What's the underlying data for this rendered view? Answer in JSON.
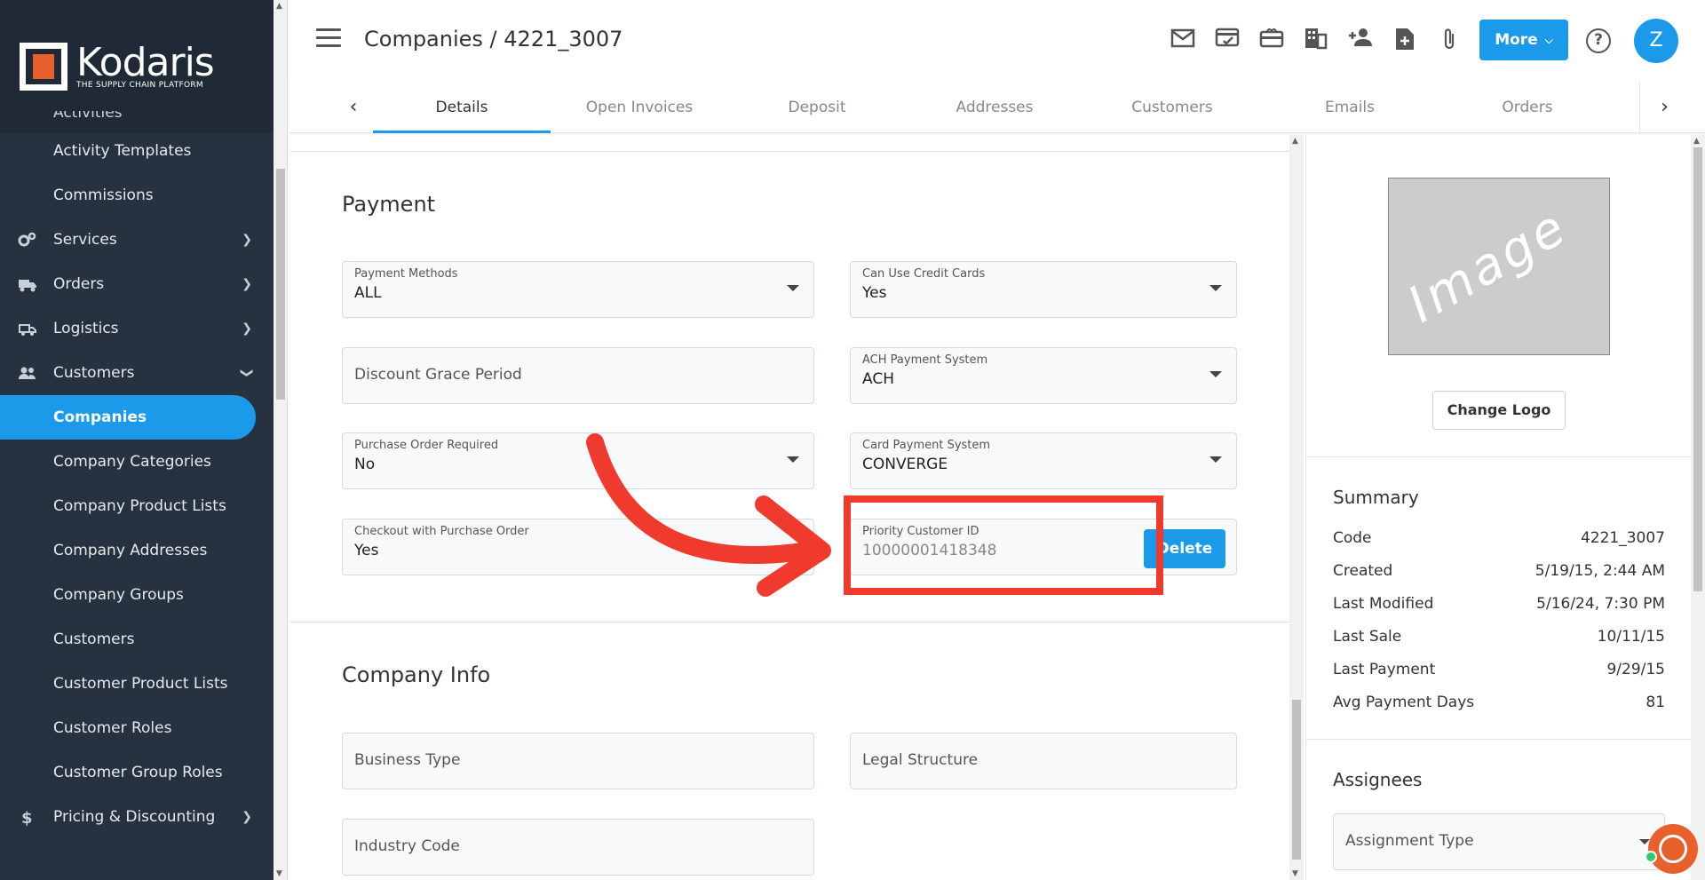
{
  "brand": {
    "name": "Kodaris",
    "tagline": "THE SUPPLY CHAIN PLATFORM",
    "accent": "#1a9ae8",
    "logo_orange": "#e8612c",
    "annotation": "#f03a2e"
  },
  "sidebar": {
    "partial_top": "Activities",
    "items": [
      {
        "label": "Activity Templates",
        "icon": null,
        "chevron": null
      },
      {
        "label": "Commissions",
        "icon": null,
        "chevron": null
      },
      {
        "label": "Services",
        "icon": "gears-icon",
        "chevron": "chevron-right"
      },
      {
        "label": "Orders",
        "icon": "truck-icon",
        "chevron": "chevron-right"
      },
      {
        "label": "Logistics",
        "icon": "delivery-icon",
        "chevron": "chevron-right"
      },
      {
        "label": "Customers",
        "icon": "users-icon",
        "chevron": "chevron-down"
      },
      {
        "label": "Companies",
        "icon": null,
        "chevron": null,
        "active": true
      },
      {
        "label": "Company Categories",
        "icon": null,
        "chevron": null
      },
      {
        "label": "Company Product Lists",
        "icon": null,
        "chevron": null
      },
      {
        "label": "Company Addresses",
        "icon": null,
        "chevron": null
      },
      {
        "label": "Company Groups",
        "icon": null,
        "chevron": null
      },
      {
        "label": "Customers",
        "icon": null,
        "chevron": null
      },
      {
        "label": "Customer Product Lists",
        "icon": null,
        "chevron": null
      },
      {
        "label": "Customer Roles",
        "icon": null,
        "chevron": null
      },
      {
        "label": "Customer Group Roles",
        "icon": null,
        "chevron": null
      },
      {
        "label": "Pricing & Discounting",
        "icon": "dollar-icon",
        "chevron": "chevron-right"
      }
    ]
  },
  "header": {
    "breadcrumb": "Companies / 4221_3007",
    "more_label": "More",
    "avatar_initial": "Z",
    "help_glyph": "?"
  },
  "tabs": [
    "Details",
    "Open Invoices",
    "Deposit",
    "Addresses",
    "Customers",
    "Emails",
    "Orders"
  ],
  "payment": {
    "title": "Payment",
    "payment_methods": {
      "label": "Payment Methods",
      "value": "ALL"
    },
    "can_use_credit_cards": {
      "label": "Can Use Credit Cards",
      "value": "Yes"
    },
    "discount_grace_period": {
      "placeholder": "Discount Grace Period"
    },
    "ach_payment_system": {
      "label": "ACH Payment System",
      "value": "ACH"
    },
    "purchase_order_required": {
      "label": "Purchase Order Required",
      "value": "No"
    },
    "card_payment_system": {
      "label": "Card Payment System",
      "value": "CONVERGE"
    },
    "checkout_with_po": {
      "label": "Checkout with Purchase Order",
      "value": "Yes"
    },
    "priority_customer_id": {
      "label": "Priority Customer ID",
      "value": "10000001418348",
      "delete_label": "Delete"
    }
  },
  "company_info": {
    "title": "Company Info",
    "business_type": "Business Type",
    "legal_structure": "Legal Structure",
    "industry_code": "Industry Code"
  },
  "right_panel": {
    "image_watermark": "Image",
    "change_logo_label": "Change Logo",
    "summary_title": "Summary",
    "summary": [
      {
        "key": "Code",
        "value": "4221_3007"
      },
      {
        "key": "Created",
        "value": "5/19/15, 2:44 AM"
      },
      {
        "key": "Last Modified",
        "value": "5/16/24, 7:30 PM"
      },
      {
        "key": "Last Sale",
        "value": "10/11/15"
      },
      {
        "key": "Last Payment",
        "value": "9/29/15"
      },
      {
        "key": "Avg Payment Days",
        "value": "81"
      }
    ],
    "assignees_title": "Assignees",
    "assignment_type_placeholder": "Assignment Type"
  }
}
